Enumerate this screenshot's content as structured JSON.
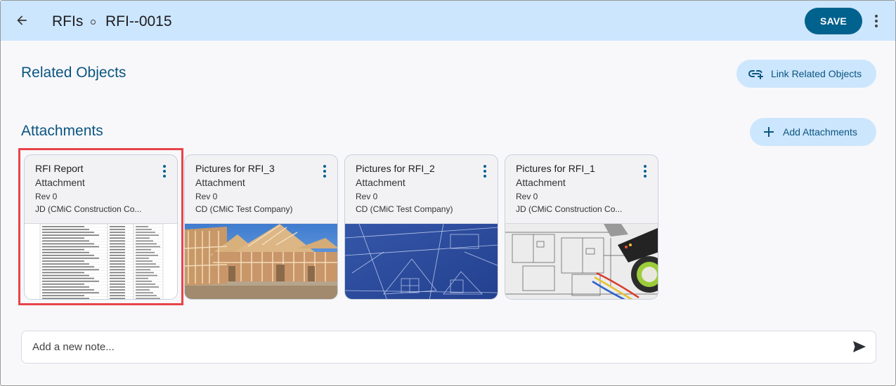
{
  "header": {
    "back_icon": "arrow-left-icon",
    "breadcrumb": [
      "RFIs",
      "RFI--0015"
    ],
    "save_label": "SAVE",
    "more_icon": "more-vertical-icon"
  },
  "related_objects": {
    "title": "Related Objects",
    "link_button": {
      "label": "Link Related Objects",
      "icon": "link-add-icon"
    }
  },
  "attachments": {
    "title": "Attachments",
    "add_button": {
      "label": "Add Attachments",
      "icon": "plus-icon"
    },
    "items": [
      {
        "title": "RFI Report",
        "type": "Attachment",
        "rev": "Rev 0",
        "owner": "JD (CMiC Construction Co...",
        "thumb": "document-table",
        "selected": true
      },
      {
        "title": "Pictures for RFI_3",
        "type": "Attachment",
        "rev": "Rev 0",
        "owner": "CD (CMiC Test Company)",
        "thumb": "house-framing-photo",
        "selected": false
      },
      {
        "title": "Pictures for RFI_2",
        "type": "Attachment",
        "rev": "Rev 0",
        "owner": "CD (CMiC Test Company)",
        "thumb": "blueprint-photo",
        "selected": false
      },
      {
        "title": "Pictures for RFI_1",
        "type": "Attachment",
        "rev": "Rev 0",
        "owner": "JD (CMiC Construction Co...",
        "thumb": "electrical-plan-photo",
        "selected": false
      }
    ]
  },
  "note": {
    "placeholder": "Add a new note...",
    "value": "",
    "send_icon": "send-icon"
  },
  "colors": {
    "header_bg": "#cce6fd",
    "primary": "#02628e",
    "section_title": "#0b5580",
    "selection": "#e8434a"
  }
}
